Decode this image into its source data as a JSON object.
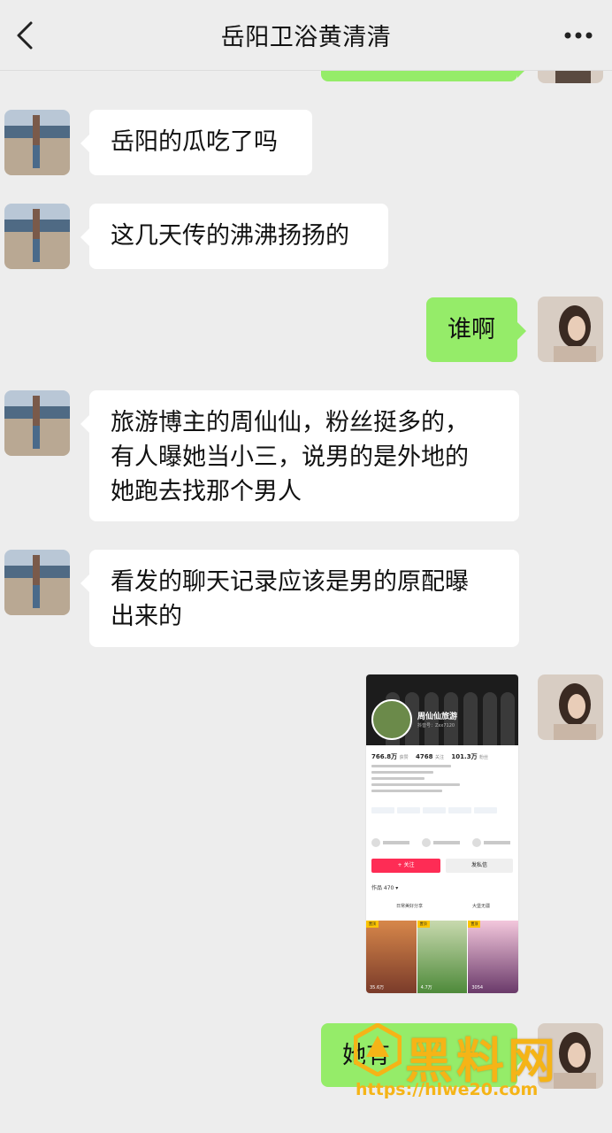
{
  "header": {
    "title": "岳阳卫浴黄清清",
    "back_icon": "chevron-left-icon",
    "more_icon": "ellipsis-icon"
  },
  "messages": [
    {
      "side": "left",
      "text": "岳阳的瓜吃了吗"
    },
    {
      "side": "left",
      "text": "这几天传的沸沸扬扬的"
    },
    {
      "side": "right",
      "text": "谁啊"
    },
    {
      "side": "left",
      "text": "旅游博主的周仙仙，粉丝挺多的，\n有人曝她当小三，说男的是外地的\n她跑去找那个男人"
    },
    {
      "side": "left",
      "text": "看发的聊天记录应该是男的原配曝\n出来的"
    },
    {
      "side": "right",
      "type": "image"
    },
    {
      "side": "right",
      "text": "她有"
    }
  ],
  "screenshot": {
    "profile_name": "周仙仙旅游",
    "profile_id": "抖音号：Zxx7120",
    "stats": [
      {
        "value": "766.8万",
        "label": "获赞"
      },
      {
        "value": "4768",
        "label": "关注"
      },
      {
        "value": "101.3万",
        "label": "粉丝"
      }
    ],
    "follow_label": "+ 关注",
    "message_label": "发私信",
    "works_label": "作品 470 ▾",
    "tab_a": "日常美好分享",
    "tab_b": "大堡无疆",
    "thumbs": [
      {
        "badge": "置顶",
        "count": "35.6万"
      },
      {
        "badge": "置顶",
        "count": "4.7万"
      },
      {
        "badge": "置顶",
        "count": "3054"
      }
    ]
  },
  "watermark": {
    "title": "黑料网",
    "url": "https://hlwe20.com"
  },
  "colors": {
    "background": "#ededed",
    "bubble_left": "#ffffff",
    "bubble_right": "#95ec69",
    "watermark": "#f5b417"
  }
}
